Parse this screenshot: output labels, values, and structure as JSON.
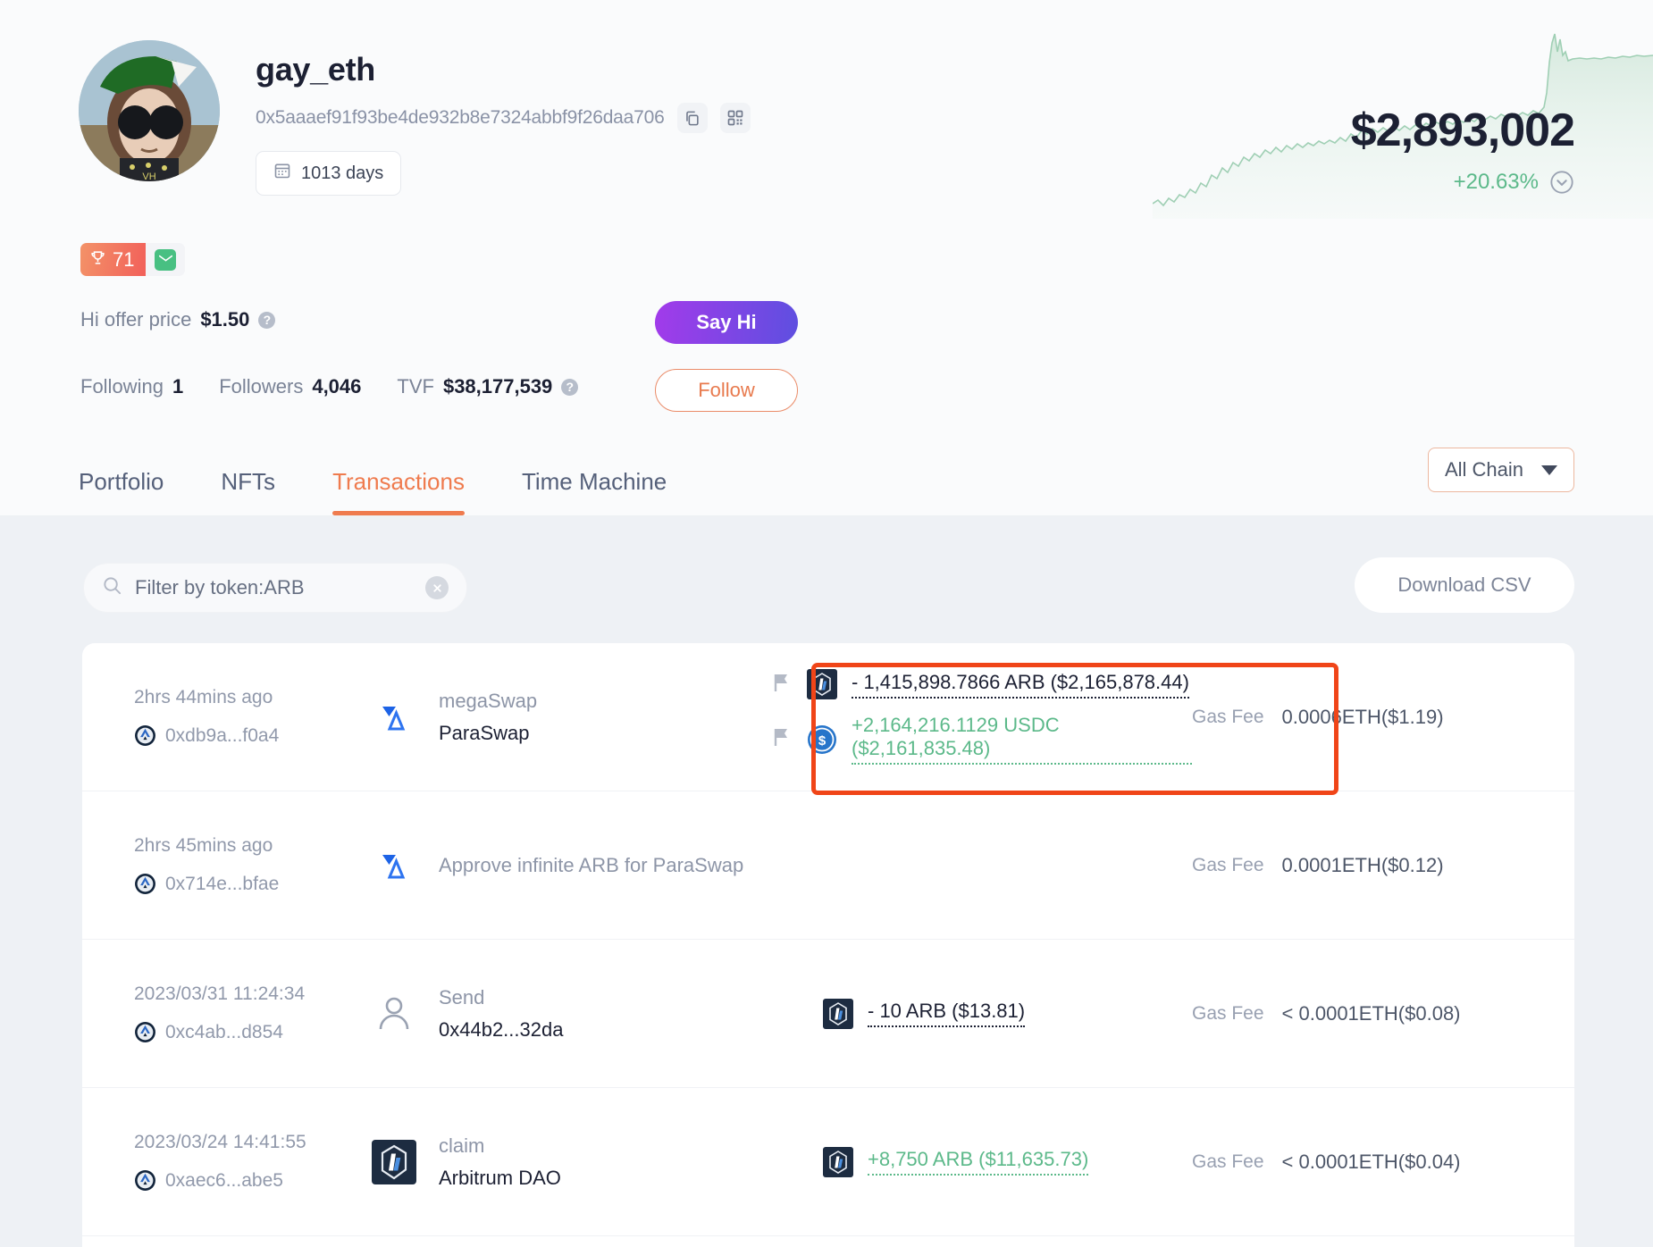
{
  "profile": {
    "username": "gay_eth",
    "address": "0x5aaaef91f93be4de932b8e7324abbf9f26daa706",
    "copy_icon": "copy-icon",
    "qr_icon": "qr-code-icon",
    "days_label": "1013 days",
    "calendar_icon": "calendar-icon",
    "rank_badge": "71",
    "trophy_icon": "trophy-icon",
    "mail_icon": "envelope-icon",
    "hi_offer_label": "Hi offer price",
    "hi_offer_value": "$1.50",
    "following_label": "Following",
    "following_value": "1",
    "followers_label": "Followers",
    "followers_value": "4,046",
    "tvf_label": "TVF",
    "tvf_value": "$38,177,539",
    "say_hi_label": "Say Hi",
    "follow_label": "Follow",
    "help_icon": "question-mark-icon"
  },
  "portfolio": {
    "total_value": "$2,893,002",
    "change_percent": "+20.63%",
    "change_color": "#5cb98a",
    "expand_icon": "chevron-down-circle-icon"
  },
  "tabs": [
    {
      "label": "Portfolio",
      "active": false
    },
    {
      "label": "NFTs",
      "active": false
    },
    {
      "label": "Transactions",
      "active": true
    },
    {
      "label": "Time Machine",
      "active": false
    }
  ],
  "chain_filter": {
    "label": "All Chain",
    "caret_icon": "caret-down-icon"
  },
  "toolbar": {
    "search_value": "Filter by token:ARB",
    "search_placeholder": "Filter by token",
    "search_icon": "search-icon",
    "clear_icon": "close-circle-icon",
    "download_label": "Download CSV"
  },
  "transactions": [
    {
      "time": "2hrs 44mins ago",
      "hash": "0xdb9a...f0a4",
      "chain_icon": "arbitrum-chain-icon",
      "action_logo": "paraswap-logo-icon",
      "action_title": "megaSwap",
      "action_sub": "ParaSwap",
      "amounts": [
        {
          "flag_icon": "flag-icon",
          "token_icon": "arb-token-icon",
          "text": "- 1,415,898.7866 ARB ($2,165,878.44)",
          "direction": "negative"
        },
        {
          "flag_icon": "flag-icon",
          "token_icon": "usdc-token-icon",
          "text": "+2,164,216.1129 USDC ($2,161,835.48)",
          "direction": "positive"
        }
      ],
      "gas_label": "Gas Fee",
      "gas_value": "0.0006ETH($1.19)",
      "highlighted": true
    },
    {
      "time": "2hrs 45mins ago",
      "hash": "0x714e...bfae",
      "chain_icon": "arbitrum-chain-icon",
      "action_logo": "paraswap-logo-icon",
      "action_title": "Approve infinite ARB for ParaSwap",
      "action_sub": "",
      "amounts": [],
      "gas_label": "Gas Fee",
      "gas_value": "0.0001ETH($0.12)",
      "highlighted": false
    },
    {
      "time": "2023/03/31 11:24:34",
      "hash": "0xc4ab...d854",
      "chain_icon": "arbitrum-chain-icon",
      "action_logo": "person-icon",
      "action_title": "Send",
      "action_sub": "0x44b2...32da",
      "amounts": [
        {
          "flag_icon": "",
          "token_icon": "arb-token-icon",
          "text": "- 10 ARB ($13.81)",
          "direction": "negative"
        }
      ],
      "gas_label": "Gas Fee",
      "gas_value": "< 0.0001ETH($0.08)",
      "highlighted": false
    },
    {
      "time": "2023/03/24 14:41:55",
      "hash": "0xaec6...abe5",
      "chain_icon": "arbitrum-chain-icon",
      "action_logo": "arbitrum-dao-icon",
      "action_title": "claim",
      "action_sub": "Arbitrum DAO",
      "amounts": [
        {
          "flag_icon": "",
          "token_icon": "arb-token-icon",
          "text": "+8,750 ARB ($11,635.73)",
          "direction": "positive"
        }
      ],
      "gas_label": "Gas Fee",
      "gas_value": "< 0.0001ETH($0.04)",
      "highlighted": false
    }
  ],
  "colors": {
    "accent_orange": "#ef7b4e",
    "positive_green": "#5cb98a",
    "highlight_red": "#f04518",
    "text_dark": "#1c2033",
    "text_muted": "#9199ab"
  }
}
